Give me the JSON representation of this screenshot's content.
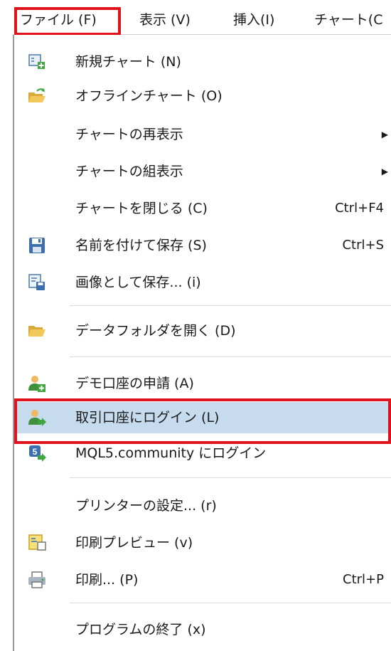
{
  "menubar": {
    "items": [
      {
        "label": "ファイル (F)"
      },
      {
        "label": "表示 (V)"
      },
      {
        "label": "挿入(I)"
      },
      {
        "label": "チャート(C"
      }
    ]
  },
  "file_menu": {
    "items": [
      {
        "label": "新規チャート (N)",
        "shortcut": "",
        "icon": "new-chart-icon"
      },
      {
        "label": "オフラインチャート (O)",
        "shortcut": "",
        "icon": "open-folder-icon"
      },
      {
        "label": "チャートの再表示",
        "shortcut": "",
        "icon": ""
      },
      {
        "label": "チャートの組表示",
        "shortcut": "",
        "icon": ""
      },
      {
        "label": "チャートを閉じる (C)",
        "shortcut": "Ctrl+F4",
        "icon": ""
      },
      {
        "label": "名前を付けて保存 (S)",
        "shortcut": "Ctrl+S",
        "icon": "save-icon"
      },
      {
        "label": "画像として保存... (i)",
        "shortcut": "",
        "icon": "save-picture-icon"
      },
      {
        "label": "データフォルダを開く (D)",
        "shortcut": "",
        "icon": "folder-icon"
      },
      {
        "label": "デモ口座の申請 (A)",
        "shortcut": "",
        "icon": "demo-account-icon"
      },
      {
        "label": "取引口座にログイン (L)",
        "shortcut": "",
        "icon": "login-account-icon"
      },
      {
        "label": "MQL5.community にログイン",
        "shortcut": "",
        "icon": "mql5-icon"
      },
      {
        "label": "プリンターの設定... (r)",
        "shortcut": "",
        "icon": ""
      },
      {
        "label": "印刷プレビュー (v)",
        "shortcut": "",
        "icon": "print-preview-icon"
      },
      {
        "label": "印刷... (P)",
        "shortcut": "Ctrl+P",
        "icon": "printer-icon"
      },
      {
        "label": "プログラムの終了 (x)",
        "shortcut": "",
        "icon": ""
      }
    ]
  },
  "colors": {
    "highlight_border": "#e0121b",
    "active_row": "#c7dbee"
  }
}
